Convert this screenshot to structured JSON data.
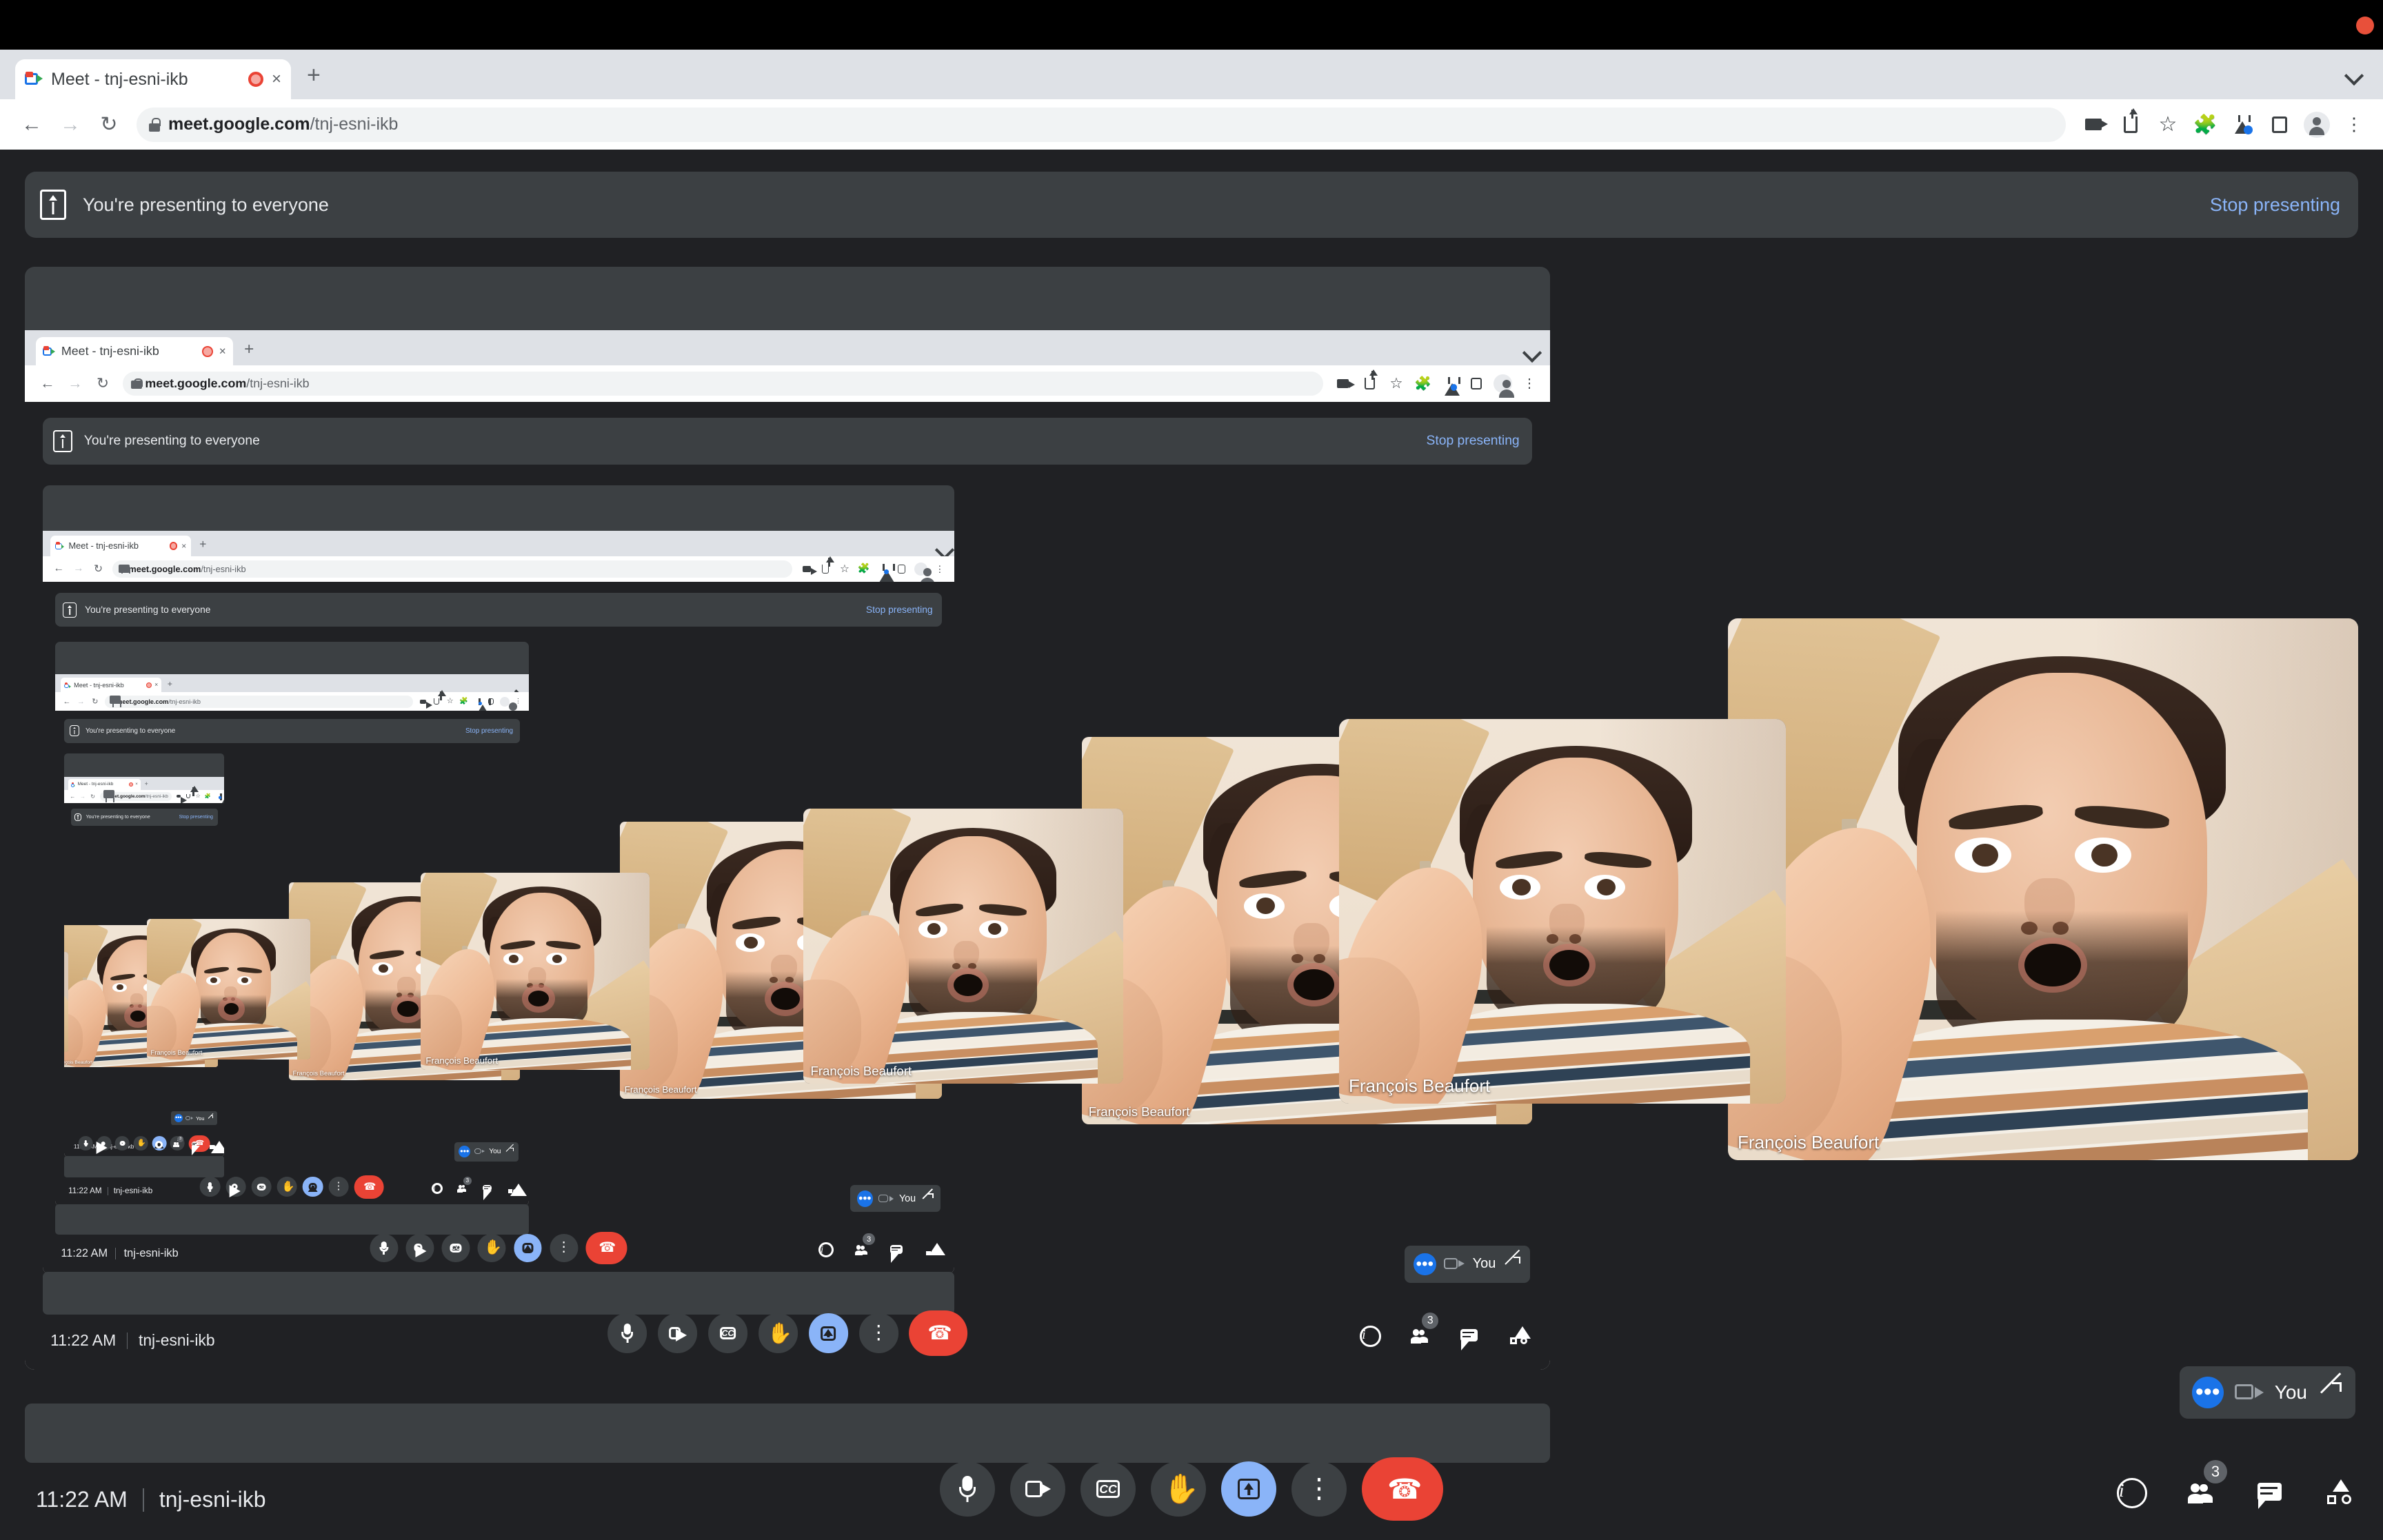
{
  "os": {
    "recording_indicator": "recording-dot",
    "bar_color": "#000000"
  },
  "browser": {
    "tab": {
      "title": "Meet - tnj-esni-ikb",
      "favicon": "google-meet-icon",
      "recording_badge": "tab-recording-icon",
      "close": "×"
    },
    "new_tab_label": "+",
    "tab_search": "chevron-down-icon",
    "nav": {
      "back": "←",
      "forward": "→",
      "reload": "↻"
    },
    "url": {
      "scheme_icon": "lock-icon",
      "host": "meet.google.com",
      "path": "/tnj-esni-ikb"
    },
    "toolbar_icons": [
      "screencast-icon",
      "share-icon",
      "bookmark-star-icon",
      "extensions-puzzle-icon",
      "experiments-flask-icon",
      "side-panel-icon",
      "profile-avatar-icon",
      "browser-menu-icon"
    ]
  },
  "meet": {
    "banner": {
      "icon": "present-screen-icon",
      "text": "You're presenting to everyone",
      "stop_label": "Stop presenting",
      "stop_color": "#8ab4f8",
      "background": "#3c4043"
    },
    "participant_name": "François Beaufort",
    "controls": {
      "time": "11:22 AM",
      "meeting_code": "tnj-esni-ikb",
      "buttons": [
        {
          "name": "microphone-button",
          "icon": "mic-icon",
          "state": "off"
        },
        {
          "name": "camera-button",
          "icon": "video-camera-icon",
          "state": "off"
        },
        {
          "name": "captions-button",
          "icon": "cc-icon",
          "label": "CC"
        },
        {
          "name": "raise-hand-button",
          "icon": "raised-hand-icon"
        },
        {
          "name": "present-now-button",
          "icon": "present-screen-icon",
          "state": "active"
        },
        {
          "name": "more-options-button",
          "icon": "more-vertical-icon"
        },
        {
          "name": "leave-call-button",
          "icon": "end-call-icon",
          "color": "#ea4335"
        }
      ],
      "right_buttons": [
        {
          "name": "meeting-details-button",
          "icon": "info-icon"
        },
        {
          "name": "show-everyone-button",
          "icon": "people-icon",
          "badge": "3"
        },
        {
          "name": "chat-button",
          "icon": "chat-bubble-icon"
        },
        {
          "name": "activities-button",
          "icon": "activities-shapes-icon"
        }
      ]
    },
    "self_view": {
      "status_icon": "more-dots-icon",
      "camera_icon": "video-camera-off-icon",
      "label": "You",
      "expand_icon": "expand-arrows-icon"
    }
  },
  "recursion": {
    "levels": 9,
    "description": "infinite-mirror screen share of the same Google Meet window"
  }
}
